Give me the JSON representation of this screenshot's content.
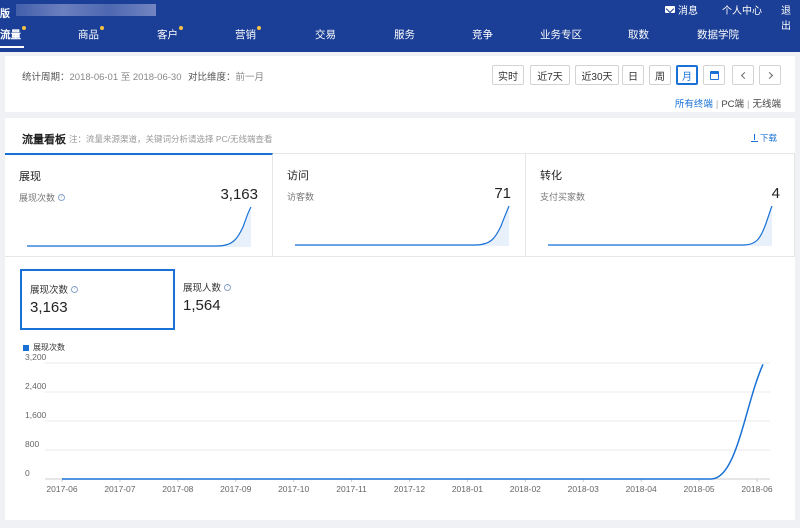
{
  "header": {
    "brand": "版",
    "utils": {
      "message": "消息",
      "user_center": "个人中心",
      "logout": "退出"
    },
    "nav": [
      {
        "label": "流量",
        "dot": true,
        "active": true
      },
      {
        "label": "商品",
        "dot": true
      },
      {
        "label": "客户",
        "dot": true
      },
      {
        "label": "营销",
        "dot": true
      },
      {
        "label": "交易"
      },
      {
        "label": "服务"
      },
      {
        "label": "竞争"
      },
      {
        "label": "业务专区"
      },
      {
        "label": "取数"
      },
      {
        "label": "数据学院"
      }
    ]
  },
  "filter": {
    "period_label": "统计周期：",
    "period_value": "2018-06-01 至 2018-06-30",
    "compare_label": "对比维度：",
    "compare_value": "前一月",
    "buttons": [
      "实时",
      "近7天",
      "近30天",
      "日",
      "周",
      "月"
    ],
    "active_button": "月",
    "terminals": [
      "所有终端",
      "PC端",
      "无线端"
    ],
    "selected_terminal": "所有终端"
  },
  "board": {
    "title": "流量看板",
    "note": "注：流量来源渠道，关键词分析请选择 PC/无线端查看",
    "download": "下载",
    "cards": [
      {
        "name": "展现",
        "metric": "展现次数",
        "value": "3,163",
        "help": true
      },
      {
        "name": "访问",
        "metric": "访客数",
        "value": "71"
      },
      {
        "name": "转化",
        "metric": "支付买家数",
        "value": "4"
      }
    ],
    "stats": [
      {
        "label": "展现次数",
        "value": "3,163",
        "help": true,
        "selected": true
      },
      {
        "label": "展现人数",
        "value": "1,564",
        "help": true
      }
    ]
  },
  "colors": {
    "nav_bg": "#1b3f96",
    "accent": "#1971d6",
    "nav_dot": "#f6c143"
  },
  "chart_data": {
    "type": "line",
    "series": [
      {
        "name": "展现次数",
        "values": [
          0,
          0,
          0,
          0,
          0,
          0,
          0,
          0,
          0,
          0,
          0,
          0,
          3163
        ]
      }
    ],
    "categories": [
      "2017-06",
      "2017-07",
      "2017-08",
      "2017-09",
      "2017-10",
      "2017-11",
      "2017-12",
      "2018-01",
      "2018-02",
      "2018-03",
      "2018-04",
      "2018-05",
      "2018-06"
    ],
    "yticks": [
      "0",
      "800",
      "1,600",
      "2,400",
      "3,200"
    ],
    "ylim": [
      0,
      3200
    ],
    "grid": true,
    "legend_position": "top-left"
  }
}
